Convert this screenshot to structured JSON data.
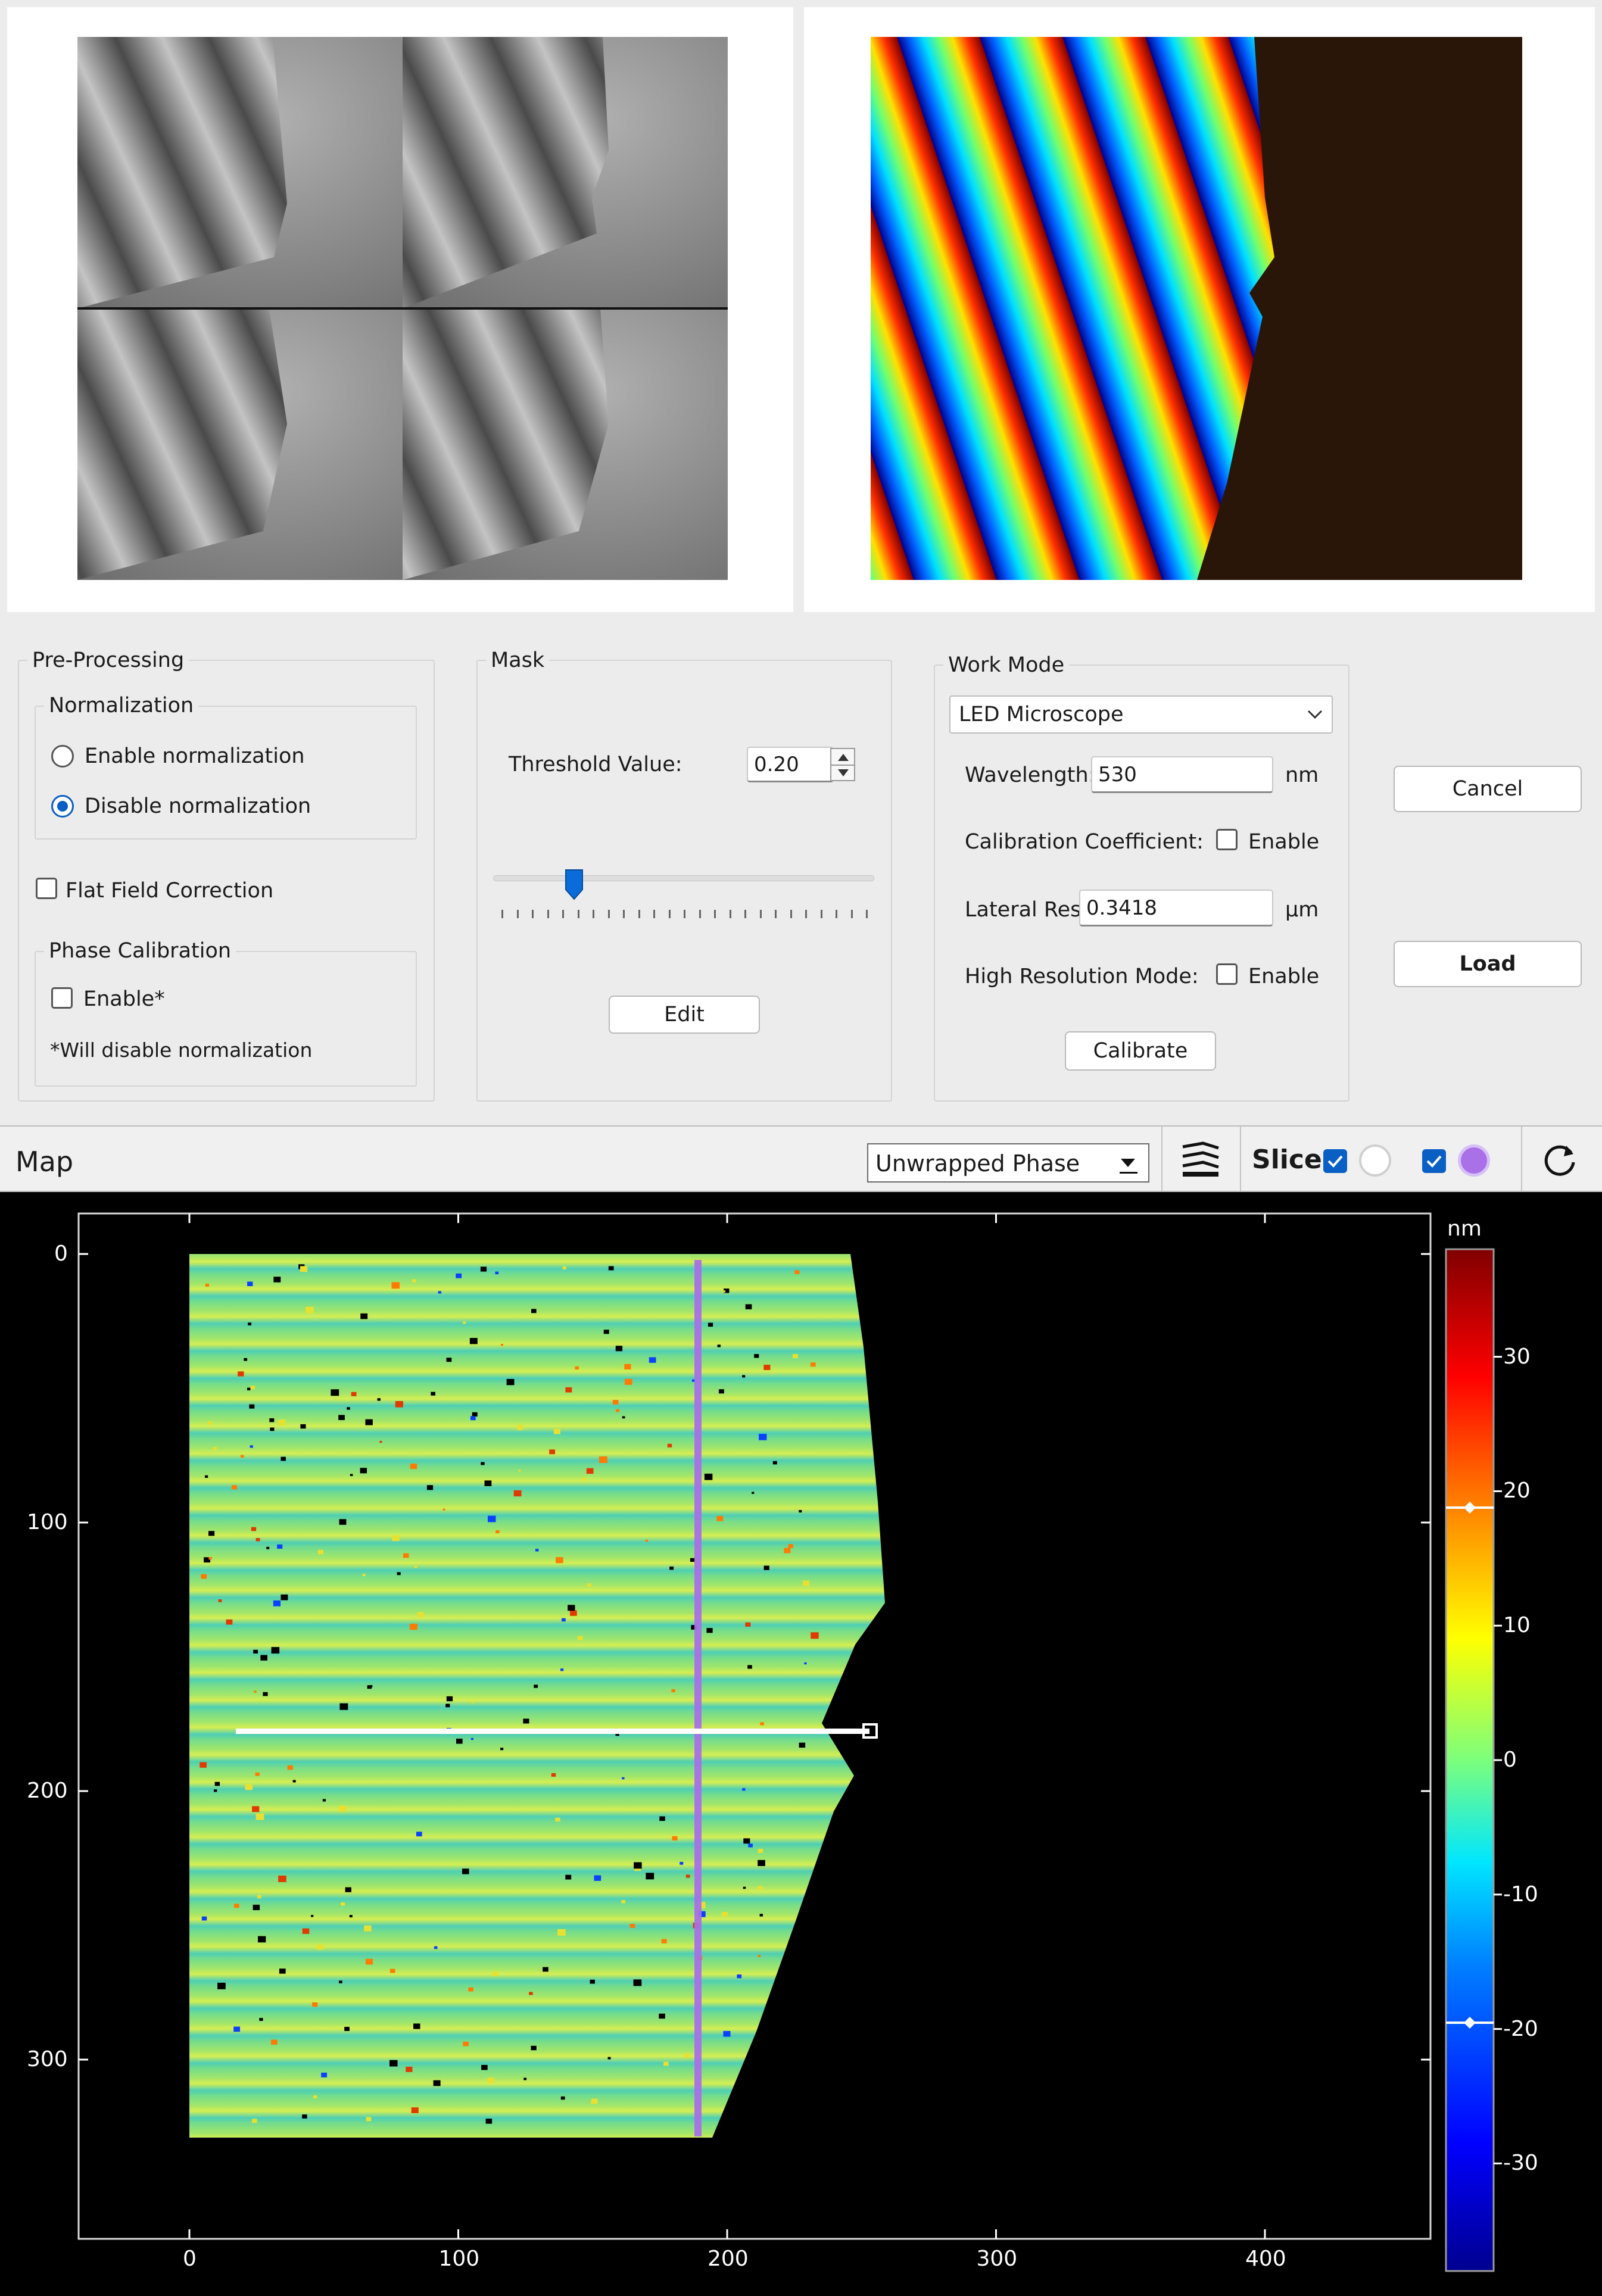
{
  "preview": {
    "raw_images_alt": "raw fringe image quadrants",
    "wrapped_phase_alt": "wrapped phase map"
  },
  "preprocessing": {
    "title": "Pre-Processing",
    "normalization": {
      "title": "Normalization",
      "enable_label": "Enable normalization",
      "disable_label": "Disable normalization",
      "selected": "disable"
    },
    "flat_field_label": "Flat Field Correction",
    "phase_calibration": {
      "title": "Phase Calibration",
      "enable_label": "Enable*",
      "note": "*Will disable normalization"
    }
  },
  "mask": {
    "title": "Mask",
    "threshold_label": "Threshold Value:",
    "threshold_value": "0.20",
    "slider_fraction": 0.2,
    "edit_label": "Edit"
  },
  "work_mode": {
    "title": "Work Mode",
    "mode_value": "LED Microscope",
    "wavelength_label": "Wavelength:",
    "wavelength_value": "530",
    "wavelength_unit": "nm",
    "calibration_label": "Calibration Coefficient:",
    "calibration_enable": "Enable",
    "lateral_label": "Lateral Res:",
    "lateral_value": "0.3418",
    "lateral_unit": "μm",
    "highres_label": "High Resolution Mode:",
    "highres_enable": "Enable",
    "calibrate_label": "Calibrate"
  },
  "actions": {
    "cancel_label": "Cancel",
    "load_label": "Load"
  },
  "map_toolbar": {
    "title": "Map",
    "view_select": "Unwrapped Phase",
    "slice_label": "Slice"
  },
  "map": {
    "x_ticks": [
      "0",
      "100",
      "200",
      "300",
      "400"
    ],
    "y_ticks": [
      "0",
      "100",
      "200",
      "300"
    ],
    "colorbar_unit": "nm",
    "colorbar_ticks": [
      "30",
      "20",
      "10",
      "0",
      "-10",
      "-20",
      "-30"
    ],
    "colorbar_range": [
      -38,
      38
    ],
    "slice_vertical_x": 189,
    "slice_horizontal_y": 177,
    "colors": {
      "accent": "#0a5fc4",
      "slice_vertical": "#a970e8"
    }
  }
}
